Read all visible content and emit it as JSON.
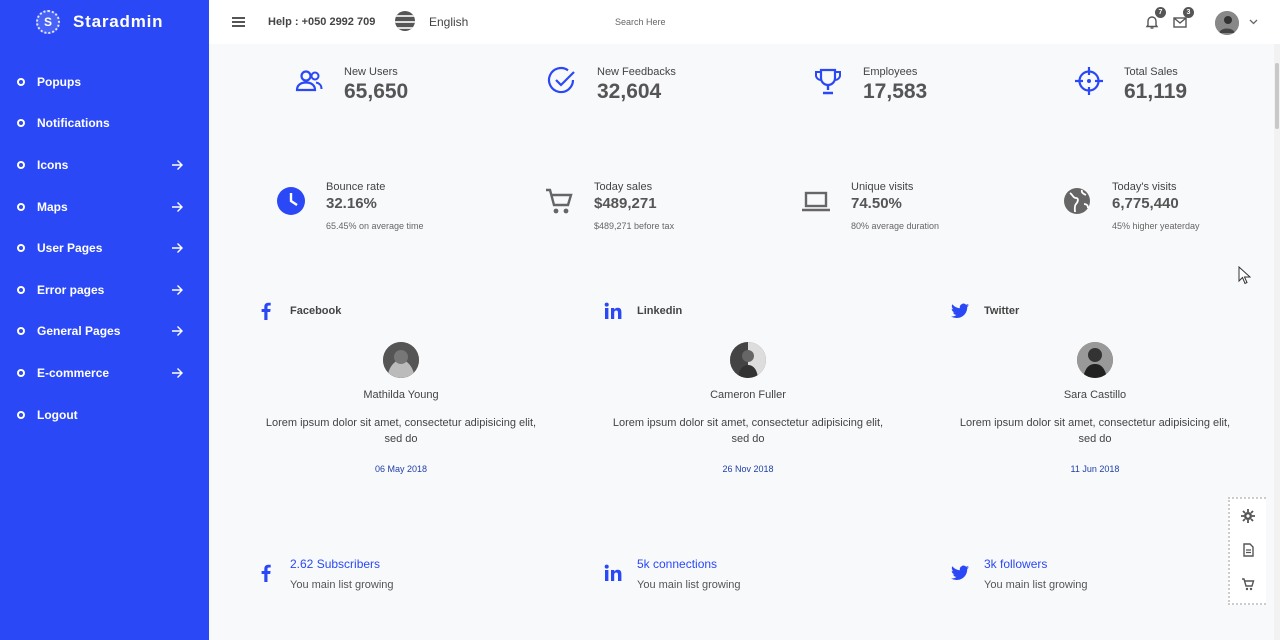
{
  "brand": {
    "logo_letter": "S",
    "name": "Staradmin"
  },
  "sidebar": {
    "items": [
      {
        "label": "Popups",
        "arrow": false
      },
      {
        "label": "Notifications",
        "arrow": false
      },
      {
        "label": "Icons",
        "arrow": true
      },
      {
        "label": "Maps",
        "arrow": true
      },
      {
        "label": "User Pages",
        "arrow": true
      },
      {
        "label": "Error pages",
        "arrow": true
      },
      {
        "label": "General Pages",
        "arrow": true
      },
      {
        "label": "E-commerce",
        "arrow": true
      },
      {
        "label": "Logout",
        "arrow": false
      }
    ]
  },
  "topbar": {
    "help": "Help : +050 2992 709",
    "language": "English",
    "search_placeholder": "Search Here",
    "notifications_count": "7",
    "messages_count": "3"
  },
  "stats": [
    {
      "label": "New Users",
      "value": "65,650",
      "icon": "users-icon"
    },
    {
      "label": "New Feedbacks",
      "value": "32,604",
      "icon": "check-circle-icon"
    },
    {
      "label": "Employees",
      "value": "17,583",
      "icon": "trophy-icon"
    },
    {
      "label": "Total Sales",
      "value": "61,119",
      "icon": "crosshair-icon"
    }
  ],
  "metrics": [
    {
      "label": "Bounce rate",
      "value": "32.16%",
      "sub": "65.45% on average time",
      "icon": "clock-icon"
    },
    {
      "label": "Today sales",
      "value": "$489,271",
      "sub": "$489,271 before tax",
      "icon": "cart-icon"
    },
    {
      "label": "Unique visits",
      "value": "74.50%",
      "sub": "80% average duration",
      "icon": "laptop-icon"
    },
    {
      "label": "Today's visits",
      "value": "6,775,440",
      "sub": "45% higher yeaterday",
      "icon": "globe-icon"
    }
  ],
  "social": [
    {
      "network": "Facebook",
      "icon": "facebook-icon",
      "person": "Mathilda Young",
      "text": "Lorem ipsum dolor sit amet, consectetur adipisicing elit, sed do",
      "date": "06 May 2018",
      "stat_title": "2.62 Subscribers",
      "stat_desc": "You main list growing"
    },
    {
      "network": "Linkedin",
      "icon": "linkedin-icon",
      "person": "Cameron Fuller",
      "text": "Lorem ipsum dolor sit amet, consectetur adipisicing elit, sed do",
      "date": "26 Nov 2018",
      "stat_title": "5k connections",
      "stat_desc": "You main list growing"
    },
    {
      "network": "Twitter",
      "icon": "twitter-icon",
      "person": "Sara Castillo",
      "text": "Lorem ipsum dolor sit amet, consectetur adipisicing elit, sed do",
      "date": "11 Jun 2018",
      "stat_title": "3k followers",
      "stat_desc": "You main list growing"
    }
  ],
  "colors": {
    "primary": "#2b48f6",
    "date": "#1f3fa8",
    "text": "#444444"
  }
}
